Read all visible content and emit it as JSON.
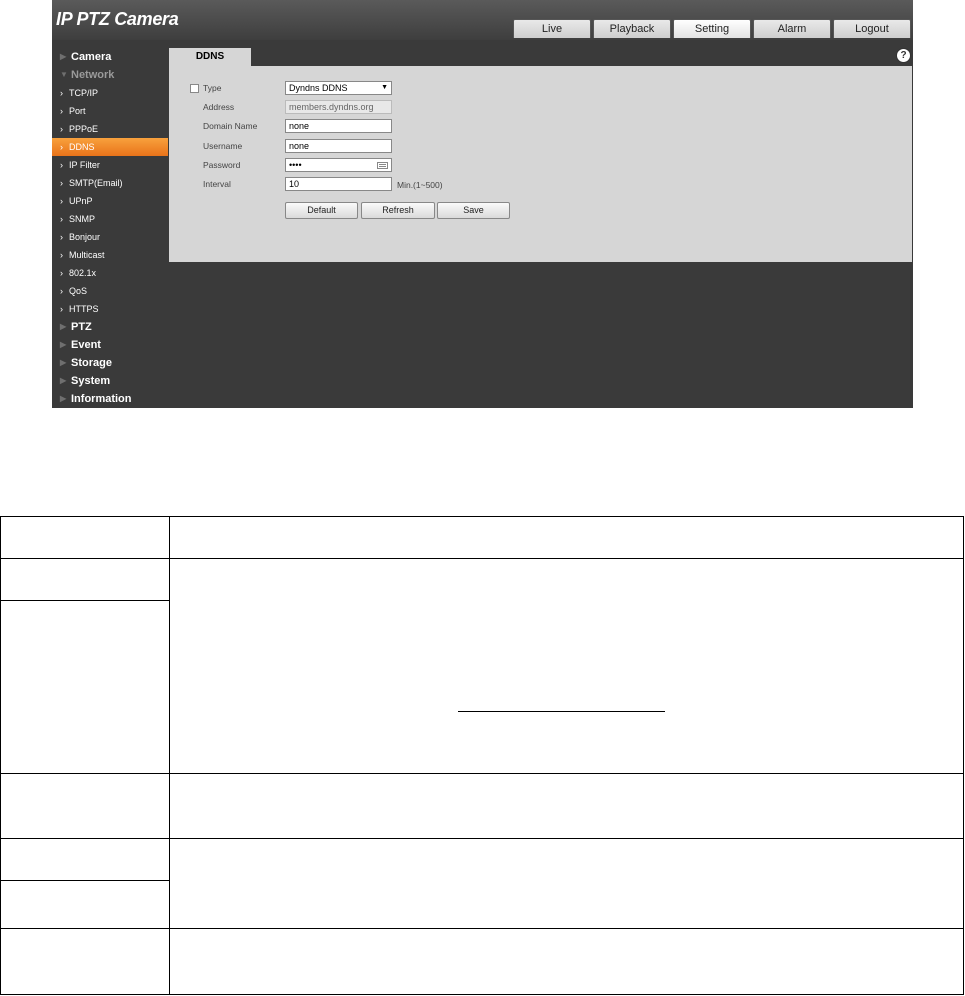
{
  "app": {
    "title": "IP PTZ Camera"
  },
  "tabs": [
    "Live",
    "Playback",
    "Setting",
    "Alarm",
    "Logout"
  ],
  "active_tab": "Setting",
  "sidebar": {
    "groups_top": [
      {
        "label": "Camera"
      },
      {
        "label": "Network"
      }
    ],
    "network_items": [
      "TCP/IP",
      "Port",
      "PPPoE",
      "DDNS",
      "IP Filter",
      "SMTP(Email)",
      "UPnP",
      "SNMP",
      "Bonjour",
      "Multicast",
      "802.1x",
      "QoS",
      "HTTPS"
    ],
    "active_item": "DDNS",
    "groups_bottom": [
      "PTZ",
      "Event",
      "Storage",
      "System",
      "Information"
    ]
  },
  "page": {
    "tab_label": "DDNS",
    "help_icon": "?",
    "form": {
      "type_label": "Type",
      "type_value": "Dyndns DDNS",
      "address_label": "Address",
      "address_value": "members.dyndns.org",
      "domain_label": "Domain Name",
      "domain_value": "none",
      "username_label": "Username",
      "username_value": "none",
      "password_label": "Password",
      "password_value": "••••",
      "interval_label": "Interval",
      "interval_value": "10",
      "interval_hint": "Min.(1~500)"
    },
    "buttons": {
      "default": "Default",
      "refresh": "Refresh",
      "save": "Save"
    }
  },
  "colors": {
    "accent": "#f28a2c",
    "panel": "#d6d6d6",
    "background": "#3a3a3a"
  }
}
